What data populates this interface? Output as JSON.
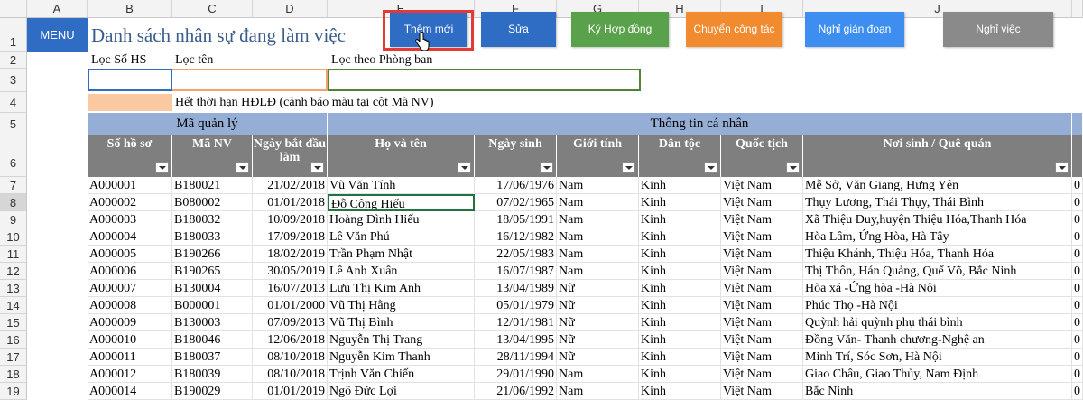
{
  "columns": [
    "A",
    "B",
    "C",
    "D",
    "E",
    "F",
    "G",
    "H",
    "I",
    "J"
  ],
  "rows": [
    "1",
    "2",
    "3",
    "4",
    "5",
    "6",
    "7",
    "8",
    "9",
    "10",
    "11",
    "12",
    "13",
    "14",
    "15",
    "16",
    "17",
    "18",
    "19"
  ],
  "menu_label": "MENU",
  "title": "Danh sách nhân sự đang làm việc",
  "buttons": [
    {
      "label": "Thêm mới",
      "color": "#2f6cc4"
    },
    {
      "label": "Sửa",
      "color": "#2f6cc4"
    },
    {
      "label": "Ký Hợp đồng",
      "color": "#5aa14b"
    },
    {
      "label": "Chuyển công tác",
      "color": "#f28a30"
    },
    {
      "label": "Nghỉ gián đoạn",
      "color": "#3d8ef0"
    },
    {
      "label": "Nghỉ việc",
      "color": "#8a8a8a"
    }
  ],
  "filters": {
    "so_hs_label": "Lọc Số HS",
    "ten_label": "Lọc tên",
    "phong_ban_label": "Lọc theo Phòng ban",
    "so_hs_value": "",
    "ten_value": "",
    "phong_ban_value": ""
  },
  "legend_text": "Hết thời hạn HĐLĐ (cảnh báo màu tại cột Mã NV)",
  "group_headers": {
    "ma_quan_ly": "Mã quản lý",
    "thong_tin": "Thông tin cá nhân"
  },
  "headers": [
    "Số hồ sơ",
    "Mã NV",
    "Ngày bắt đầu làm",
    "Họ và tên",
    "Ngày sinh",
    "Giới tính",
    "Dân tộc",
    "Quốc tịch",
    "Nơi sinh / Quê quán"
  ],
  "records": [
    [
      "A000001",
      "B180021",
      "21/02/2018",
      "Vũ Văn Tính",
      "17/06/1976",
      "Nam",
      "Kinh",
      "Việt Nam",
      "Mễ Sở, Văn Giang, Hưng Yên"
    ],
    [
      "A000002",
      "B080002",
      "01/01/2018",
      "Đỗ Công Hiếu",
      "07/02/1965",
      "Nam",
      "Kinh",
      "Việt Nam",
      "Thụy Lương, Thái Thụy, Thái Bình"
    ],
    [
      "A000003",
      "B180032",
      "10/09/2018",
      "Hoàng Đình Hiếu",
      "18/05/1991",
      "Nam",
      "Kinh",
      "Việt Nam",
      "Xã Thiệu Duy,huyện Thiệu Hóa,Thanh Hóa"
    ],
    [
      "A000004",
      "B180033",
      "17/09/2018",
      "Lê Văn Phú",
      "16/12/1982",
      "Nam",
      "Kinh",
      "Việt Nam",
      "Hòa Lâm, Ứng Hòa, Hà Tây"
    ],
    [
      "A000005",
      "B190266",
      "18/02/2019",
      "Trần Phạm Nhật",
      "22/05/1983",
      "Nam",
      "Kinh",
      "Việt Nam",
      "Thiệu Khánh, Thiệu Hóa, Thanh Hóa"
    ],
    [
      "A000006",
      "B190265",
      "30/05/2019",
      "Lê Anh Xuân",
      "16/07/1987",
      "Nam",
      "Kinh",
      "Việt Nam",
      "Thị Thôn, Hán Quảng, Quế Võ, Bắc Ninh"
    ],
    [
      "A000007",
      "B130004",
      "16/07/2013",
      "Lưu Thị Kim Anh",
      "13/04/1989",
      "Nữ",
      "Kinh",
      "Việt Nam",
      "Hòa xá -Ứng hòa -Hà Nội"
    ],
    [
      "A000008",
      "B000001",
      "01/01/2000",
      "Vũ Thị Hằng",
      "05/01/1979",
      "Nữ",
      "Kinh",
      "Việt Nam",
      "Phúc Thọ -Hà Nội"
    ],
    [
      "A000009",
      "B130003",
      "07/09/2013",
      "Vũ Thị Bình",
      "12/01/1981",
      "Nữ",
      "Kinh",
      "Việt Nam",
      "Quỳnh hải quỳnh phụ thái bình"
    ],
    [
      "A000010",
      "B180046",
      "12/06/2018",
      "Nguyễn Thị Trang",
      "13/04/1995",
      "Nữ",
      "Kinh",
      "Việt Nam",
      "Đồng Văn- Thanh chương-Nghệ an"
    ],
    [
      "A000011",
      "B180037",
      "08/10/2018",
      "Nguyễn Kim Thanh",
      "28/11/1994",
      "Nữ",
      "Kinh",
      "Việt Nam",
      "Minh Trí, Sóc Sơn, Hà Nội"
    ],
    [
      "A000012",
      "B180039",
      "08/10/2018",
      "Trịnh Văn Chiến",
      "29/01/1990",
      "Nam",
      "Kinh",
      "Việt Nam",
      "Giao Châu, Giao Thủy, Nam Định"
    ],
    [
      "A000014",
      "B190029",
      "01/01/2019",
      "Ngô Đức Lợi",
      "21/06/1992",
      "Nam",
      "Kinh",
      "Việt Nam",
      "Bắc Ninh"
    ]
  ],
  "last_col_fragment": "0",
  "colors": {
    "header_blue": "#94aed5",
    "header_gray": "#7f7f7f",
    "highlight_orange": "#fbc9a1",
    "green_border": "#548235",
    "button_outline": "#e53935"
  }
}
